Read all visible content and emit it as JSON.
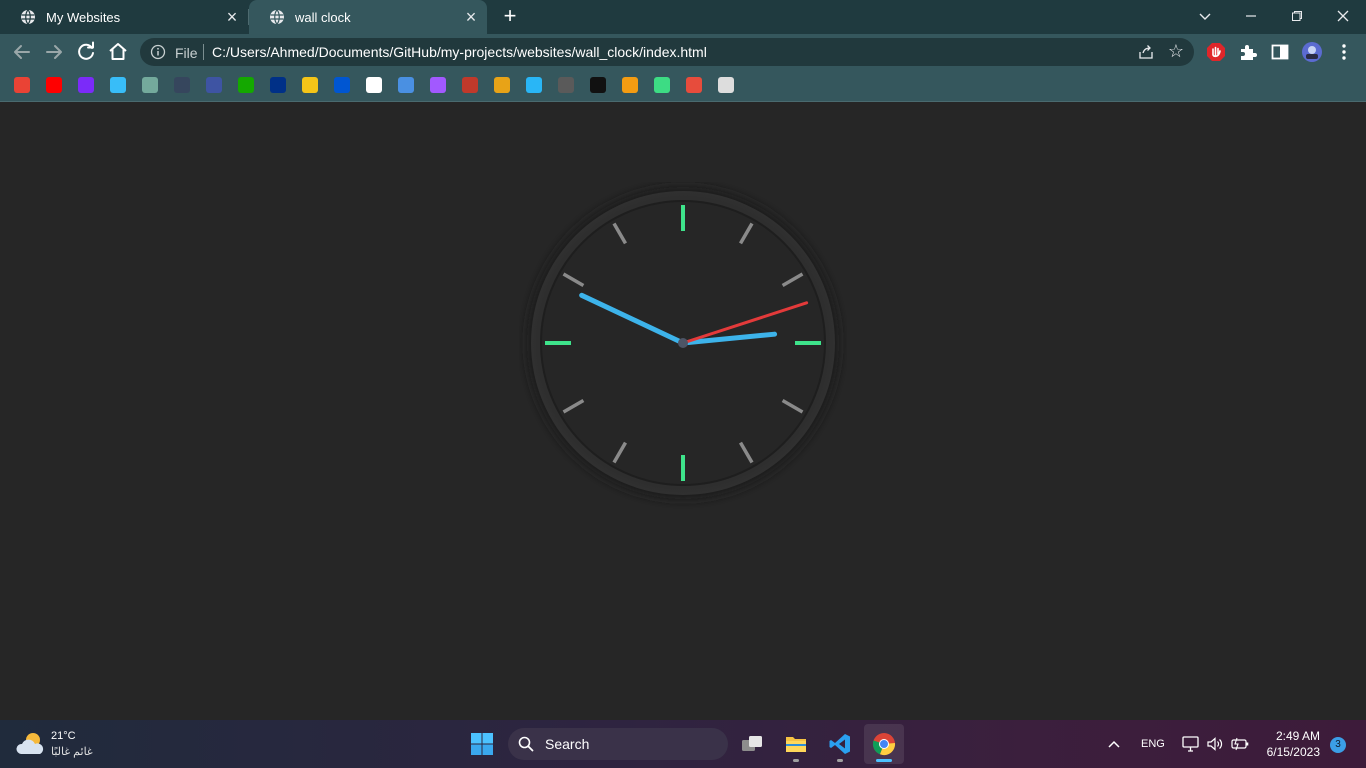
{
  "browser": {
    "tabs": [
      {
        "title": "My Websites",
        "active": false
      },
      {
        "title": "wall clock",
        "active": true
      }
    ],
    "address": {
      "scheme_label": "File",
      "url": "C:/Users/Ahmed/Documents/GitHub/my-projects/websites/wall_clock/index.html"
    },
    "bookmarks": [
      {
        "icon": "gmail-icon",
        "color": "#ea4335"
      },
      {
        "icon": "youtube-icon",
        "color": "#ff0000"
      },
      {
        "icon": "bootstrap-icon",
        "color": "#7b2bf9"
      },
      {
        "icon": "tailwind-icon",
        "color": "#38bdf8"
      },
      {
        "icon": "chatgpt-icon",
        "color": "#74aa9c"
      },
      {
        "icon": "tumblr-icon",
        "color": "#36465d"
      },
      {
        "icon": "frontend-mentor-icon",
        "color": "#3e54a3"
      },
      {
        "icon": "upwork-icon",
        "color": "#14a800"
      },
      {
        "icon": "paypal-icon",
        "color": "#003087"
      },
      {
        "icon": "extension-bookmark-icon",
        "color": "#f5c518"
      },
      {
        "icon": "coursera-icon",
        "color": "#0056d2"
      },
      {
        "icon": "github-icon",
        "color": "#ffffff"
      },
      {
        "icon": "flag-bookmark-icon",
        "color": "#4a90e2"
      },
      {
        "icon": "chat-bubble-icon",
        "color": "#a259ff"
      },
      {
        "icon": "grid-bookmark-icon",
        "color": "#c0392b"
      },
      {
        "icon": "html5-icon",
        "color": "#e8a317"
      },
      {
        "icon": "circle-bookmark-icon",
        "color": "#29b6f6"
      },
      {
        "icon": "loading-bookmark-icon",
        "color": "#5a5a5a"
      },
      {
        "icon": "pennant-icon",
        "color": "#111111"
      },
      {
        "icon": "diamond-bookmark-icon",
        "color": "#f39c12"
      },
      {
        "icon": "stripes-bookmark-icon",
        "color": "#3ddc84"
      },
      {
        "icon": "ticket-bookmark-icon",
        "color": "#e74c3c"
      },
      {
        "icon": "frame-bookmark-icon",
        "color": "#dddddd"
      }
    ]
  },
  "clock": {
    "hours": 2,
    "minutes": 49,
    "seconds": 12,
    "colors": {
      "face": "#262626",
      "rim": "#2c2c2c",
      "major_tick": "#3ee38b",
      "minor_tick": "#8a8a8a",
      "hour_hand": "#3db3ea",
      "minute_hand": "#3db3ea",
      "second_hand": "#e33a3a",
      "center": "#4d5566"
    }
  },
  "taskbar": {
    "weather": {
      "temp": "21°C",
      "description": "غائم غالبًا"
    },
    "search_placeholder": "Search",
    "language": "ENG",
    "time": "2:49 AM",
    "date": "6/15/2023",
    "notification_count": "3"
  }
}
